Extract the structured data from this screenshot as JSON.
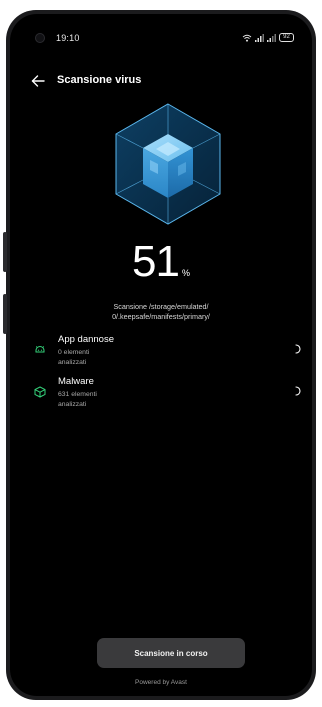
{
  "status_bar": {
    "time": "19:10",
    "battery": "92",
    "icons": [
      "wifi-icon",
      "signal-icon",
      "signal-icon",
      "battery-icon"
    ]
  },
  "header": {
    "back_icon": "arrow-left-icon",
    "title": "Scansione virus"
  },
  "progress": {
    "value": "51",
    "unit": "%",
    "path": "Scansione /storage/emulated/ 0/.keepsafe/manifests/primary/"
  },
  "scan_items": [
    {
      "icon": "android-icon",
      "title": "App dannose",
      "detail": "0 elementi analizzati"
    },
    {
      "icon": "cube-icon",
      "title": "Malware",
      "detail": "631 elementi analizzati"
    }
  ],
  "button": {
    "label": "Scansione in corso"
  },
  "footer": {
    "powered_by": "Powered by Avast"
  },
  "colors": {
    "background": "#000000",
    "accent_green": "#34d27a",
    "cube_blue": "#4aa7e0",
    "button": "#3a3a3c"
  }
}
